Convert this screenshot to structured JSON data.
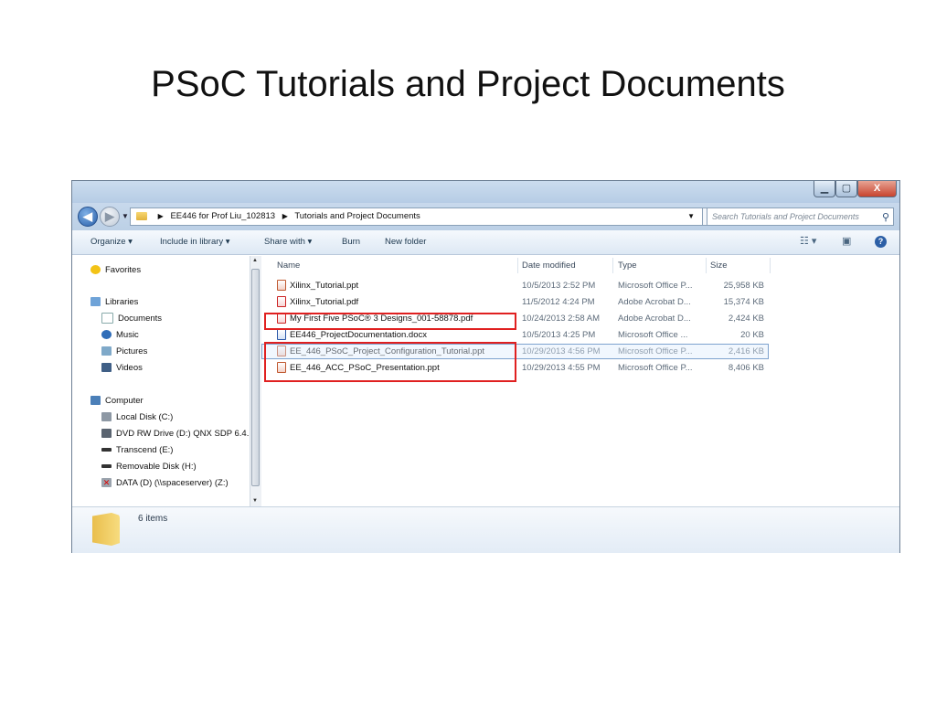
{
  "slide": {
    "title": "PSoC Tutorials and Project Documents"
  },
  "window": {
    "controls": {
      "minimize": "▁",
      "maximize": "▢",
      "close": "X"
    },
    "address": {
      "crumbs": [
        "EE446 for Prof Liu_102813",
        "Tutorials and Project Documents"
      ],
      "search_placeholder": "Search Tutorials and Project Documents"
    },
    "toolbar": {
      "organize": "Organize ▾",
      "include_in_library": "Include in library ▾",
      "share_with": "Share with ▾",
      "burn": "Burn",
      "new_folder": "New folder"
    },
    "nav": {
      "favorites": "Favorites",
      "libraries": "Libraries",
      "library_items": [
        "Documents",
        "Music",
        "Pictures",
        "Videos"
      ],
      "computer": "Computer",
      "drives": [
        "Local Disk (C:)",
        "DVD RW Drive (D:) QNX SDP 6.4.",
        "Transcend (E:)",
        "Removable Disk (H:)",
        "DATA (D) (\\\\spaceserver) (Z:)"
      ]
    },
    "columns": {
      "name": "Name",
      "date": "Date modified",
      "type": "Type",
      "size": "Size"
    },
    "files": [
      {
        "name": "Xilinx_Tutorial.ppt",
        "date": "10/5/2013 2:52 PM",
        "type": "Microsoft Office P...",
        "size": "25,958 KB",
        "icon": "ppt-file-icon"
      },
      {
        "name": "Xilinx_Tutorial.pdf",
        "date": "11/5/2012 4:24 PM",
        "type": "Adobe Acrobat D...",
        "size": "15,374 KB",
        "icon": "pdf-file-icon"
      },
      {
        "name": "My First Five PSoC® 3 Designs_001-58878.pdf",
        "date": "10/24/2013 2:58 AM",
        "type": "Adobe Acrobat D...",
        "size": "2,424 KB",
        "icon": "pdf-file-icon"
      },
      {
        "name": "EE446_ProjectDocumentation.docx",
        "date": "10/5/2013 4:25 PM",
        "type": "Microsoft Office ...",
        "size": "20 KB",
        "icon": "docx-file-icon"
      },
      {
        "name": "EE_446_PSoC_Project_Configuration_Tutorial.ppt",
        "date": "10/29/2013 4:56 PM",
        "type": "Microsoft Office P...",
        "size": "2,416 KB",
        "icon": "ppt-file-icon"
      },
      {
        "name": "EE_446_ACC_PSoC_Presentation.ppt",
        "date": "10/29/2013 4:55 PM",
        "type": "Microsoft Office P...",
        "size": "8,406 KB",
        "icon": "ppt-file-icon"
      }
    ],
    "status": {
      "item_count": "6 items"
    },
    "colors": {
      "highlight": "#e02020",
      "accent": "#2c5fa6"
    }
  }
}
